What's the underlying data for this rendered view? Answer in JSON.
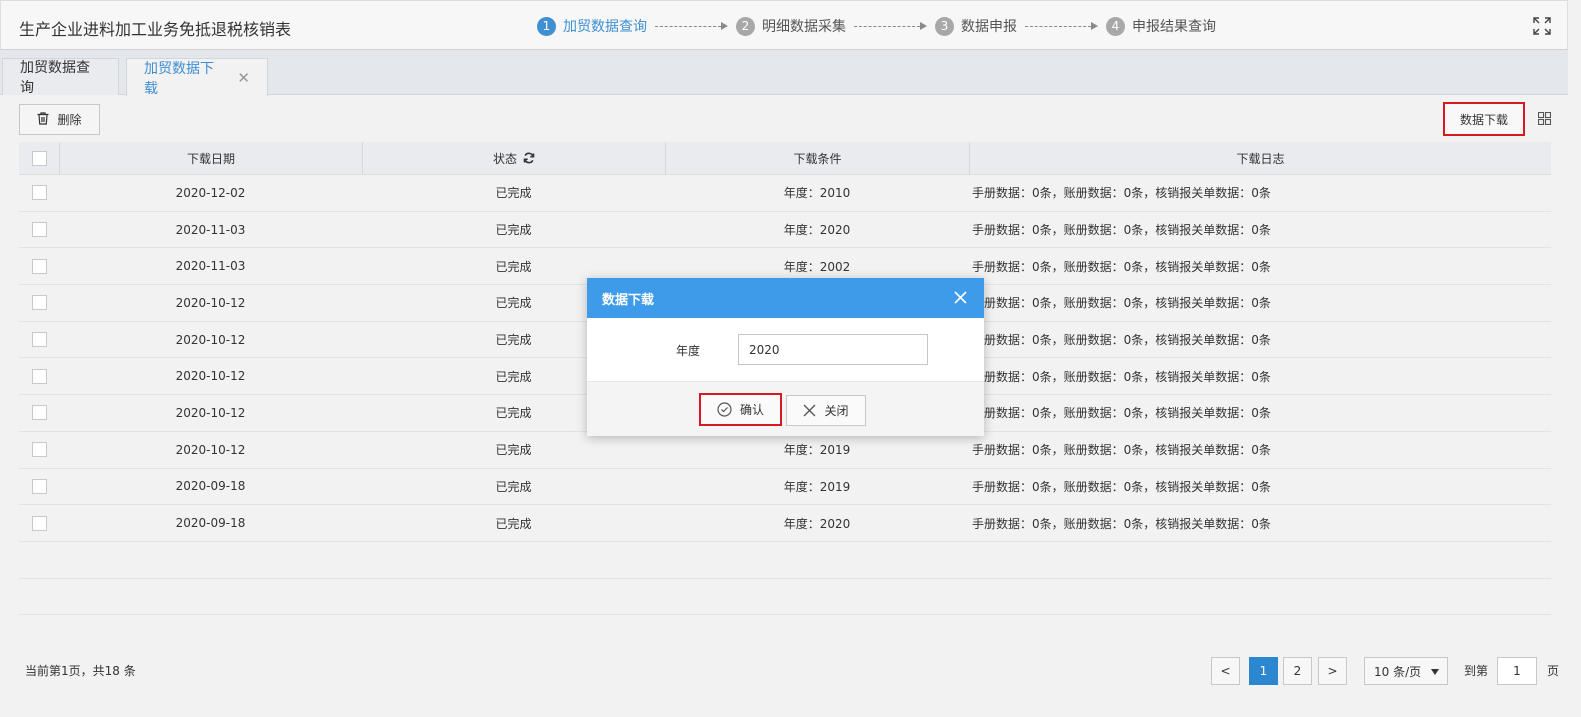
{
  "header": {
    "title": "生产企业进料加工业务免抵退税核销表",
    "steps": [
      {
        "num": "1",
        "label": "加贸数据查询"
      },
      {
        "num": "2",
        "label": "明细数据采集"
      },
      {
        "num": "3",
        "label": "数据申报"
      },
      {
        "num": "4",
        "label": "申报结果查询"
      }
    ],
    "expand_icon": "fullscreen-icon"
  },
  "tabs": [
    {
      "label": "加贸数据查询"
    },
    {
      "label": "加贸数据下载",
      "close": "✕"
    }
  ],
  "toolbar": {
    "delete_label": "删除",
    "download_label": "数据下载"
  },
  "table": {
    "columns": [
      "下载日期",
      "状态",
      "下载条件",
      "下载日志"
    ],
    "rows": [
      {
        "date": "2020-12-02",
        "status": "已完成",
        "cond": "年度：2010",
        "log": "手册数据：0条，账册数据：0条，核销报关单数据：0条"
      },
      {
        "date": "2020-11-03",
        "status": "已完成",
        "cond": "年度：2020",
        "log": "手册数据：0条，账册数据：0条，核销报关单数据：0条"
      },
      {
        "date": "2020-11-03",
        "status": "已完成",
        "cond": "年度：2002",
        "log": "手册数据：0条，账册数据：0条，核销报关单数据：0条"
      },
      {
        "date": "2020-10-12",
        "status": "已完成",
        "cond": "",
        "log": "手册数据：0条，账册数据：0条，核销报关单数据：0条"
      },
      {
        "date": "2020-10-12",
        "status": "已完成",
        "cond": "",
        "log": "手册数据：0条，账册数据：0条，核销报关单数据：0条"
      },
      {
        "date": "2020-10-12",
        "status": "已完成",
        "cond": "",
        "log": "手册数据：0条，账册数据：0条，核销报关单数据：0条"
      },
      {
        "date": "2020-10-12",
        "status": "已完成",
        "cond": "",
        "log": "手册数据：0条，账册数据：0条，核销报关单数据：0条"
      },
      {
        "date": "2020-10-12",
        "status": "已完成",
        "cond": "年度：2019",
        "log": "手册数据：0条，账册数据：0条，核销报关单数据：0条"
      },
      {
        "date": "2020-09-18",
        "status": "已完成",
        "cond": "年度：2019",
        "log": "手册数据：0条，账册数据：0条，核销报关单数据：0条"
      },
      {
        "date": "2020-09-18",
        "status": "已完成",
        "cond": "年度：2020",
        "log": "手册数据：0条，账册数据：0条，核销报关单数据：0条"
      }
    ]
  },
  "footer": {
    "info": "当前第1页，共18 条",
    "pages": [
      "1",
      "2"
    ],
    "prev": "<",
    "next": ">",
    "per_page": "10 条/页",
    "goto_label": "到第",
    "goto_value": "1",
    "goto_suffix": "页"
  },
  "modal": {
    "title": "数据下载",
    "field_label": "年度",
    "field_value": "2020",
    "ok_label": "确认",
    "cancel_label": "关闭"
  },
  "colors": {
    "accent": "#3f8fd2",
    "modal_header": "#3d9be9",
    "highlight_border": "#d71920",
    "active_page": "#2d87d0"
  }
}
